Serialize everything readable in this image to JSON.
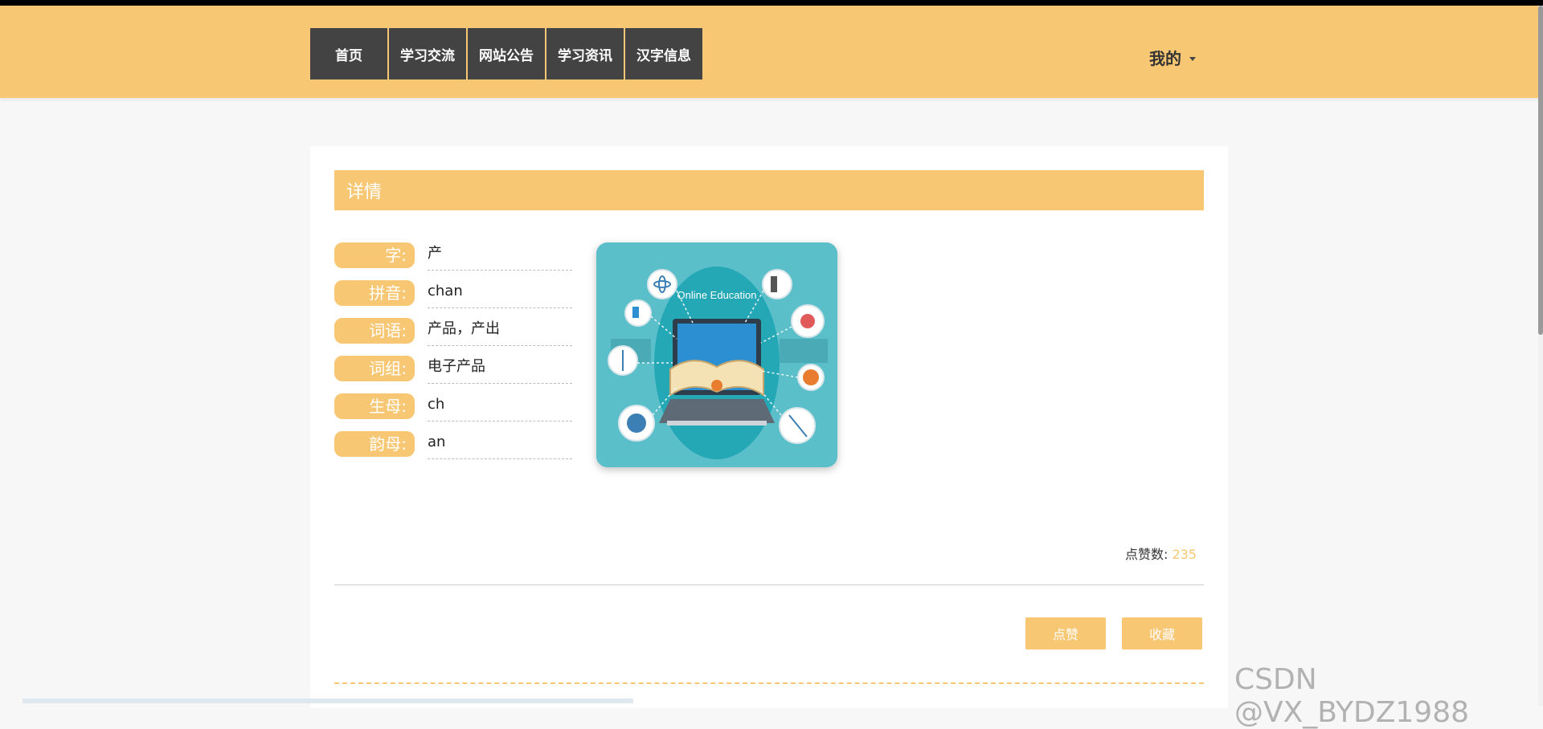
{
  "nav": {
    "items": [
      {
        "label": "首页"
      },
      {
        "label": "学习交流"
      },
      {
        "label": "网站公告"
      },
      {
        "label": "学习资讯"
      },
      {
        "label": "汉字信息"
      }
    ],
    "my_label": "我的"
  },
  "detail": {
    "title": "详情",
    "fields": [
      {
        "label": "字:",
        "value": "产"
      },
      {
        "label": "拼音:",
        "value": "chan"
      },
      {
        "label": "词语:",
        "value": "产品，产出"
      },
      {
        "label": "词组:",
        "value": "电子产品"
      },
      {
        "label": "生母:",
        "value": "ch"
      },
      {
        "label": "韵母:",
        "value": "an"
      }
    ],
    "image_caption": "Online Education",
    "likes_label": "点赞数:",
    "likes_count": "235",
    "like_button": "点赞",
    "favorite_button": "收藏"
  },
  "watermark": "CSDN @VX_BYDZ1988",
  "colors": {
    "accent": "#f8c773",
    "nav_bg": "#434343"
  }
}
